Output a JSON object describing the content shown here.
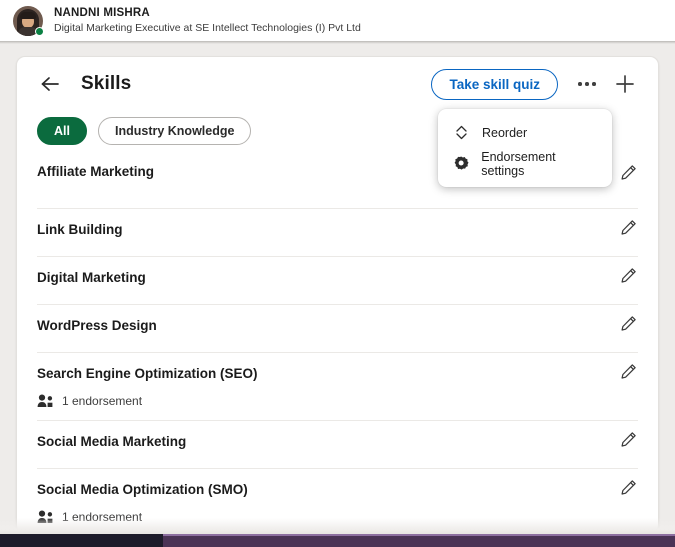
{
  "profile": {
    "name": "NANDNI MISHRA",
    "headline": "Digital Marketing Executive at SE Intellect Technologies (I) Pvt Ltd",
    "avatar_icon": "user-avatar",
    "status_icon": "online-status-dot",
    "status_color": "#0b8043"
  },
  "header": {
    "back_icon": "arrow-left-icon",
    "title": "Skills",
    "quiz_button": "Take skill quiz",
    "quiz_button_color": "#0a66c2",
    "more_icon": "more-horizontal-icon",
    "add_icon": "plus-icon"
  },
  "filters": [
    {
      "label": "All",
      "active": true,
      "color": "#0b6b3e"
    },
    {
      "label": "Industry Knowledge",
      "active": false,
      "color": "#b5b3b0"
    }
  ],
  "menu": {
    "items": [
      {
        "label": "Reorder",
        "icon": "reorder-chevrons-icon"
      },
      {
        "label": "Endorsement settings",
        "icon": "gear-icon"
      }
    ]
  },
  "skills": [
    {
      "name": "Affiliate Marketing",
      "endorsement": null,
      "edit_icon": "pencil-icon"
    },
    {
      "name": "Link Building",
      "endorsement": null,
      "edit_icon": "pencil-icon"
    },
    {
      "name": "Digital Marketing",
      "endorsement": null,
      "edit_icon": "pencil-icon"
    },
    {
      "name": "WordPress Design",
      "endorsement": null,
      "edit_icon": "pencil-icon"
    },
    {
      "name": "Search Engine Optimization (SEO)",
      "endorsement": "1 endorsement",
      "endorsement_icon": "people-icon",
      "edit_icon": "pencil-icon"
    },
    {
      "name": "Social Media Marketing",
      "endorsement": null,
      "edit_icon": "pencil-icon"
    },
    {
      "name": "Social Media Optimization (SMO)",
      "endorsement": "1 endorsement",
      "endorsement_icon": "people-icon",
      "edit_icon": "pencil-icon"
    }
  ]
}
